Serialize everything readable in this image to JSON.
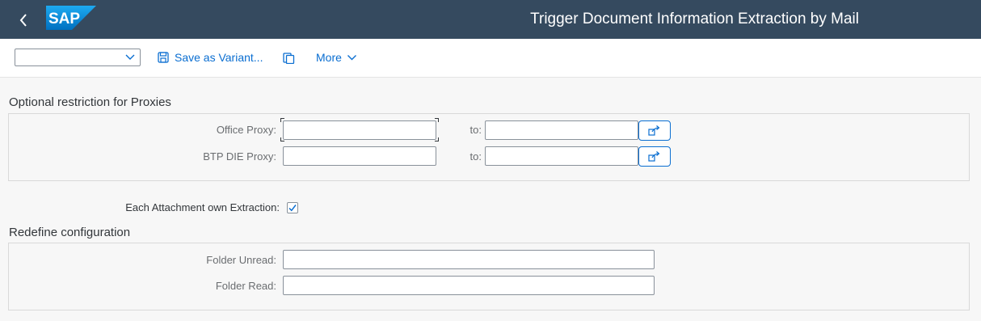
{
  "header": {
    "title": "Trigger Document Information Extraction by Mail",
    "logo_text": "SAP",
    "back_icon": "back-chevron-icon"
  },
  "toolbar": {
    "variant_value": "",
    "save_variant_label": "Save as Variant...",
    "more_label": "More"
  },
  "proxies": {
    "title": "Optional restriction for Proxies",
    "office_proxy_label": "Office Proxy:",
    "btp_proxy_label": "BTP DIE Proxy:",
    "to_label": "to:",
    "office_proxy_from": "",
    "office_proxy_to": "",
    "btp_proxy_from": "",
    "btp_proxy_to": ""
  },
  "attachment": {
    "label": "Each Attachment own Extraction:",
    "checked": true
  },
  "config": {
    "title": "Redefine configuration",
    "folder_unread_label": "Folder Unread:",
    "folder_read_label": "Folder Read:",
    "folder_unread_value": "",
    "folder_read_value": ""
  },
  "colors": {
    "shell_background": "#354a5f",
    "accent": "#0a6ed1",
    "page_background": "#f7f7f7"
  }
}
